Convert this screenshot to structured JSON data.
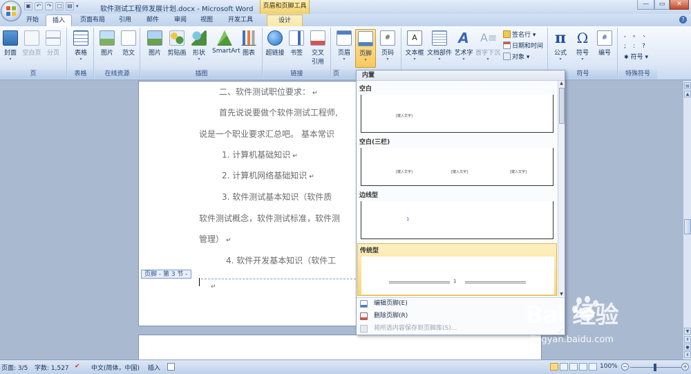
{
  "titlebar": {
    "document_title": "软件测试工程师发展计划.docx - Microsoft Word",
    "context_tools": "页眉和页脚工具",
    "quick_access": [
      "save-icon",
      "undo-icon",
      "redo-icon",
      "new-icon",
      "open-icon"
    ],
    "min": "—",
    "max": "▭",
    "close": "✕"
  },
  "tabs": [
    "开始",
    "插入",
    "页面布局",
    "引用",
    "邮件",
    "审阅",
    "视图",
    "开发工具",
    "设计"
  ],
  "active_tab": "插入",
  "ribbon": {
    "groups": {
      "page": "页",
      "table": "表格",
      "online": "在线资源",
      "illustrations": "插图",
      "links": "链接",
      "headerfooter": "页",
      "text": "",
      "symbols": "符号",
      "special": "特殊符号"
    },
    "buttons": {
      "cover": "封面",
      "blank_page": "空白页",
      "page_break": "分页",
      "table": "表格",
      "picture_online": "图片",
      "template": "范文",
      "picture": "图片",
      "clipart": "剪贴画",
      "shapes": "形状",
      "smartart": "SmartArt",
      "chart": "图表",
      "hyperlink": "超链接",
      "bookmark": "书签",
      "crossref_1": "交叉",
      "crossref_2": "引用",
      "header": "页眉",
      "footer": "页脚",
      "page_number": "页码",
      "textbox": "文本框",
      "quickparts": "文档部件",
      "wordart": "艺术字",
      "dropcap": "首字下沉",
      "signature": "签名行",
      "datetime": "日期和时间",
      "object": "对象",
      "equation": "公式",
      "symbol": "符号",
      "number": "编号",
      "special_symbols": "符号"
    },
    "special_chars": [
      ",",
      "。",
      "、",
      ";",
      ":",
      "?"
    ]
  },
  "document": {
    "paragraphs": [
      "二、软件测试职位要求：",
      "首先说说要做个软件测试工程师,",
      "说是一个职业要求汇总吧。 基本常识",
      "1.   计算机基础知识",
      "2.   计算机网络基础知识",
      "3.   软件测试基本知识（软件质",
      "软件测试概念，软件测试标准，软件测",
      "管理）",
      "4.   软件开发基本知识（软件工"
    ],
    "para_mark": "↵",
    "footer_tag": "页脚 - 第 3 节 -"
  },
  "gallery": {
    "header": "内置",
    "items": [
      {
        "title": "空白",
        "placeholders": [
          "[键入文字]"
        ]
      },
      {
        "title": "空白(三栏)",
        "placeholders": [
          "[键入文字]",
          "[键入文字]",
          "[键入文字]"
        ]
      },
      {
        "title": "边线型",
        "placeholders": [
          "1"
        ]
      },
      {
        "title": "传统型",
        "placeholders": [
          "1"
        ]
      }
    ],
    "commands": {
      "edit": "编辑页脚(E)",
      "remove": "删除页脚(R)",
      "save": "将所选内容保存到页脚库(S)..."
    }
  },
  "statusbar": {
    "page": "页面: 3/5",
    "words": "字数: 1,527",
    "language": "中文(简体，中国)",
    "mode": "插入",
    "zoom": "100%",
    "zoom_value": 100
  },
  "watermark": {
    "logo": "Bai  经验",
    "url": "jingyan.baidu.com"
  },
  "colors": {
    "ribbon_bg": "#dde8f6",
    "highlight": "#fbd678",
    "doc_bg": "#a9b9d0",
    "text_gray": "#6b6b6b"
  }
}
